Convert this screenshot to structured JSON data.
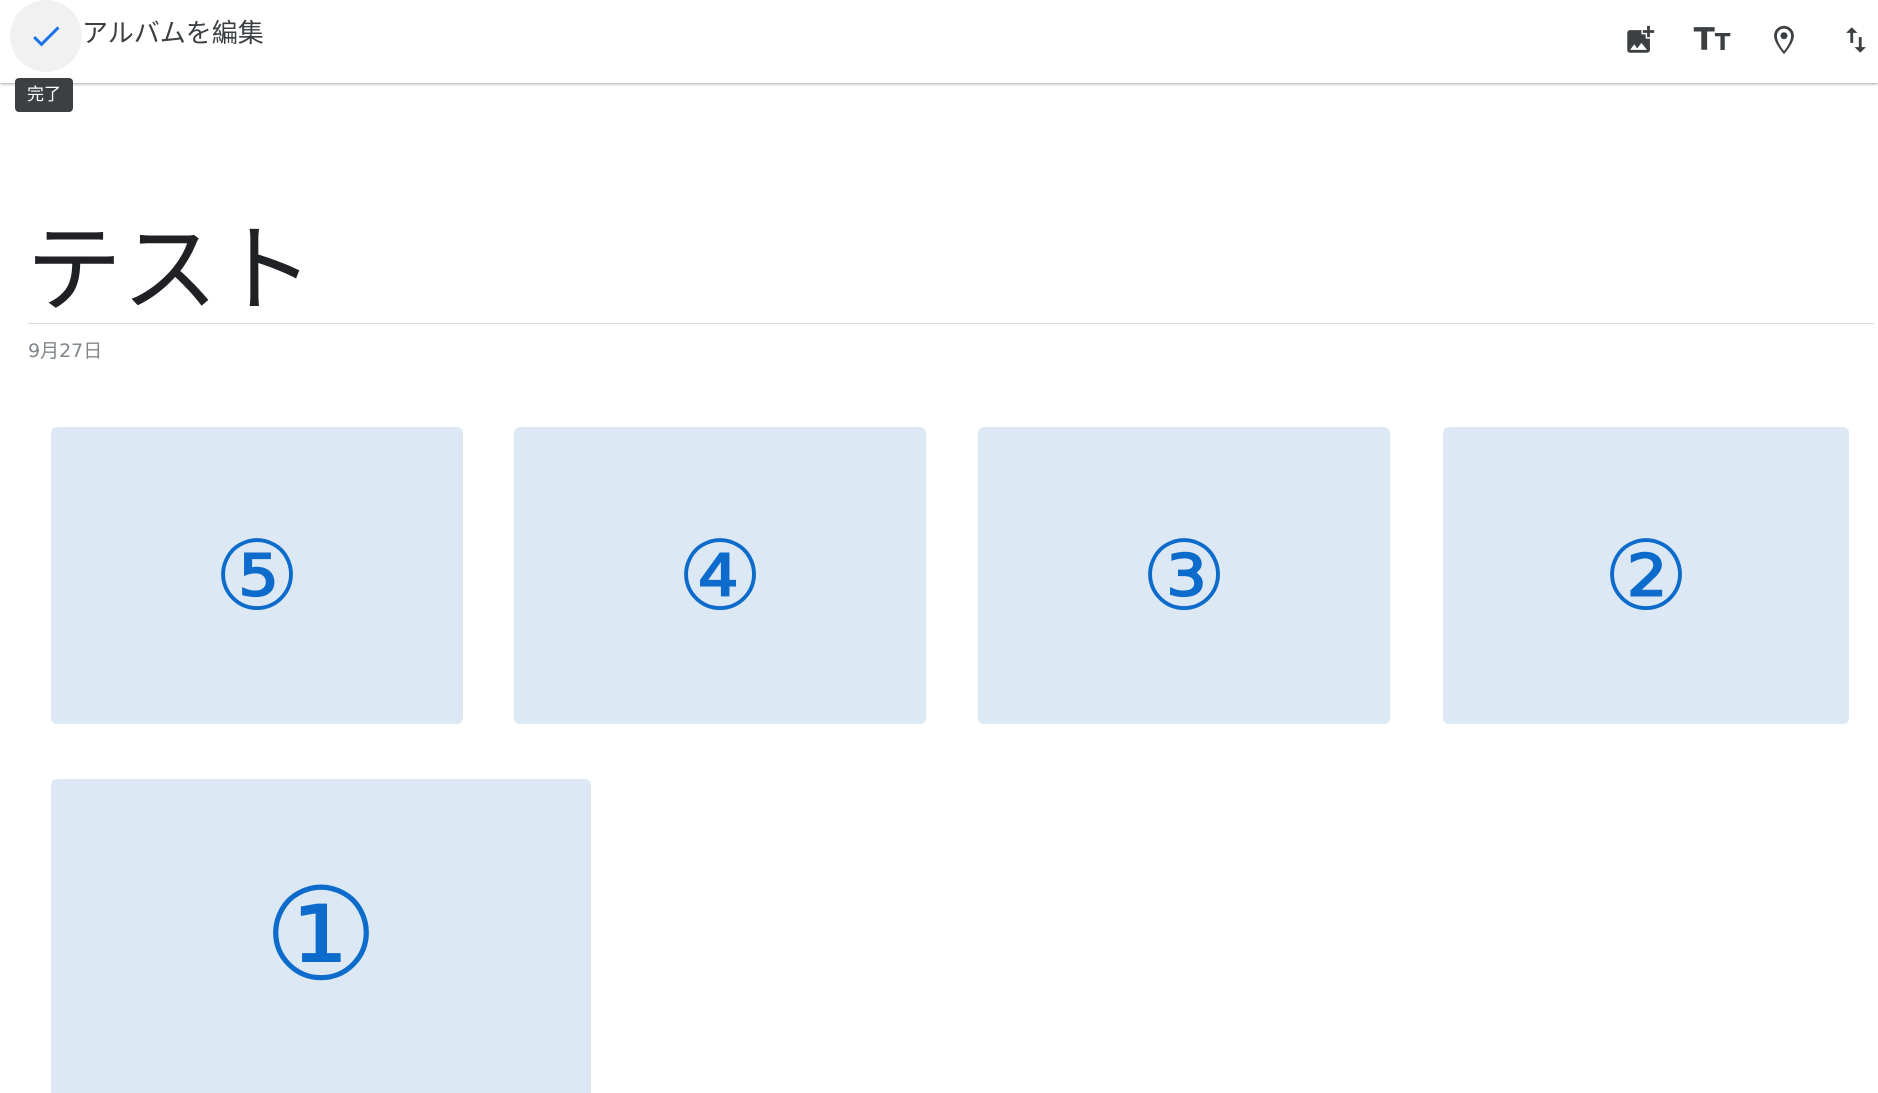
{
  "header": {
    "title": "アルバムを編集",
    "done_tooltip": "完了",
    "done_icon": "check-icon",
    "tools": [
      {
        "name": "add-photos-icon"
      },
      {
        "name": "add-text-icon"
      },
      {
        "name": "add-location-icon"
      },
      {
        "name": "sort-icon"
      }
    ]
  },
  "album": {
    "title": "テスト",
    "date": "9月27日"
  },
  "photos": [
    {
      "label": "⑤"
    },
    {
      "label": "④"
    },
    {
      "label": "③"
    },
    {
      "label": "②"
    },
    {
      "label": "①"
    }
  ],
  "colors": {
    "accent": "#1a73e8",
    "photo_bg": "#dce9f5",
    "photo_text": "#0d6bcb"
  }
}
